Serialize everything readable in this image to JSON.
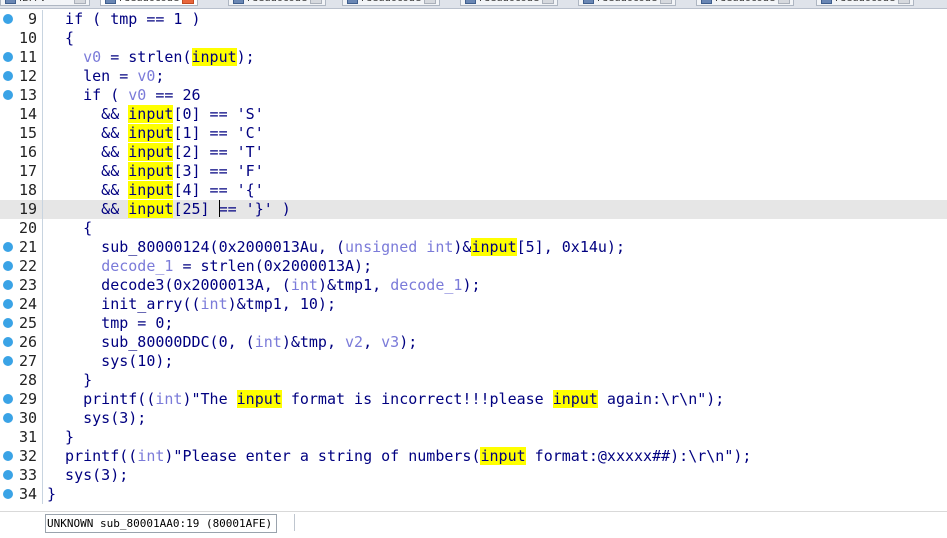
{
  "tabs": [
    {
      "label": "IDA V",
      "active": false
    },
    {
      "label": "Pseudocode",
      "active": true
    },
    {
      "label": "Pseudocode",
      "active": false
    },
    {
      "label": "Pseudocode",
      "active": false
    },
    {
      "label": "Pseudocode",
      "active": false
    },
    {
      "label": "Pseudocode",
      "active": false
    },
    {
      "label": "Pseudocode",
      "active": false
    },
    {
      "label": "Pseudocode",
      "active": false
    }
  ],
  "code_lines": [
    {
      "num": "9",
      "dot": true,
      "tokens": [
        [
          "  if ( tmp == 1 )",
          "k"
        ]
      ]
    },
    {
      "num": "10",
      "dot": false,
      "tokens": [
        [
          "  {",
          "k"
        ]
      ]
    },
    {
      "num": "11",
      "dot": true,
      "tokens": [
        [
          "    ",
          "k"
        ],
        [
          "v0",
          "lv"
        ],
        [
          " = strlen(",
          "k"
        ],
        [
          "input",
          "h"
        ],
        [
          ");",
          "k"
        ]
      ]
    },
    {
      "num": "12",
      "dot": true,
      "tokens": [
        [
          "    len = ",
          "k"
        ],
        [
          "v0",
          "lv"
        ],
        [
          ";",
          "k"
        ]
      ]
    },
    {
      "num": "13",
      "dot": true,
      "tokens": [
        [
          "    if ( ",
          "k"
        ],
        [
          "v0",
          "lv"
        ],
        [
          " == 26",
          "k"
        ]
      ]
    },
    {
      "num": "14",
      "dot": false,
      "tokens": [
        [
          "      && ",
          "k"
        ],
        [
          "input",
          "h"
        ],
        [
          "[0] == 'S'",
          "k"
        ]
      ]
    },
    {
      "num": "15",
      "dot": false,
      "tokens": [
        [
          "      && ",
          "k"
        ],
        [
          "input",
          "h"
        ],
        [
          "[1] == 'C'",
          "k"
        ]
      ]
    },
    {
      "num": "16",
      "dot": false,
      "tokens": [
        [
          "      && ",
          "k"
        ],
        [
          "input",
          "h"
        ],
        [
          "[2] == 'T'",
          "k"
        ]
      ]
    },
    {
      "num": "17",
      "dot": false,
      "tokens": [
        [
          "      && ",
          "k"
        ],
        [
          "input",
          "h"
        ],
        [
          "[3] == 'F'",
          "k"
        ]
      ]
    },
    {
      "num": "18",
      "dot": false,
      "tokens": [
        [
          "      && ",
          "k"
        ],
        [
          "input",
          "h"
        ],
        [
          "[4] == '{'",
          "k"
        ]
      ]
    },
    {
      "num": "19",
      "dot": false,
      "hl": true,
      "tokens": [
        [
          "      && ",
          "k"
        ],
        [
          "input",
          "h"
        ],
        [
          "[25] ",
          "k"
        ],
        [
          "",
          "caret"
        ],
        [
          "== '}' )",
          "k"
        ]
      ]
    },
    {
      "num": "20",
      "dot": false,
      "tokens": [
        [
          "    {",
          "k"
        ]
      ]
    },
    {
      "num": "21",
      "dot": true,
      "tokens": [
        [
          "      sub_80000124(0x2000013Au, (",
          "k"
        ],
        [
          "unsigned int",
          "lv"
        ],
        [
          ")&",
          "k"
        ],
        [
          "input",
          "h"
        ],
        [
          "[5], 0x14u);",
          "k"
        ]
      ]
    },
    {
      "num": "22",
      "dot": true,
      "tokens": [
        [
          "      ",
          "k"
        ],
        [
          "decode_1",
          "lv"
        ],
        [
          " = strlen(0x2000013A);",
          "k"
        ]
      ]
    },
    {
      "num": "23",
      "dot": true,
      "tokens": [
        [
          "      decode3(0x2000013A, (",
          "k"
        ],
        [
          "int",
          "lv"
        ],
        [
          ")&tmp1, ",
          "k"
        ],
        [
          "decode_1",
          "lv"
        ],
        [
          ");",
          "k"
        ]
      ]
    },
    {
      "num": "24",
      "dot": true,
      "tokens": [
        [
          "      init_arry((",
          "k"
        ],
        [
          "int",
          "lv"
        ],
        [
          ")&tmp1, 10);",
          "k"
        ]
      ]
    },
    {
      "num": "25",
      "dot": true,
      "tokens": [
        [
          "      tmp = 0;",
          "k"
        ]
      ]
    },
    {
      "num": "26",
      "dot": true,
      "tokens": [
        [
          "      sub_80000DDC(0, (",
          "k"
        ],
        [
          "int",
          "lv"
        ],
        [
          ")&tmp, ",
          "k"
        ],
        [
          "v2",
          "lv"
        ],
        [
          ", ",
          "k"
        ],
        [
          "v3",
          "lv"
        ],
        [
          ");",
          "k"
        ]
      ]
    },
    {
      "num": "27",
      "dot": true,
      "tokens": [
        [
          "      sys(10);",
          "k"
        ]
      ]
    },
    {
      "num": "28",
      "dot": false,
      "tokens": [
        [
          "    }",
          "k"
        ]
      ]
    },
    {
      "num": "29",
      "dot": true,
      "tokens": [
        [
          "    printf((",
          "k"
        ],
        [
          "int",
          "lv"
        ],
        [
          ")\"The ",
          "k"
        ],
        [
          "input",
          "h"
        ],
        [
          " format is incorrect!!!please ",
          "k"
        ],
        [
          "input",
          "h"
        ],
        [
          " again:\\r\\n\");",
          "k"
        ]
      ]
    },
    {
      "num": "30",
      "dot": true,
      "tokens": [
        [
          "    sys(3);",
          "k"
        ]
      ]
    },
    {
      "num": "31",
      "dot": false,
      "tokens": [
        [
          "  }",
          "k"
        ]
      ]
    },
    {
      "num": "32",
      "dot": true,
      "tokens": [
        [
          "  printf((",
          "k"
        ],
        [
          "int",
          "lv"
        ],
        [
          ")\"Please enter a string of numbers(",
          "k"
        ],
        [
          "input",
          "h"
        ],
        [
          " format:@xxxxx##):\\r\\n\");",
          "k"
        ]
      ]
    },
    {
      "num": "33",
      "dot": true,
      "tokens": [
        [
          "  sys(3);",
          "k"
        ]
      ]
    },
    {
      "num": "34",
      "dot": true,
      "tokens": [
        [
          "}",
          "k"
        ]
      ]
    }
  ],
  "status": {
    "text": "UNKNOWN sub_80001AA0:19 (80001AFE)"
  },
  "colors": {
    "keyword": "#000080",
    "local_var": "#7b7bd9",
    "highlight": "#ffff00",
    "breakpoint_dot": "#3aa3e6",
    "current_line": "#e6e6e6"
  }
}
